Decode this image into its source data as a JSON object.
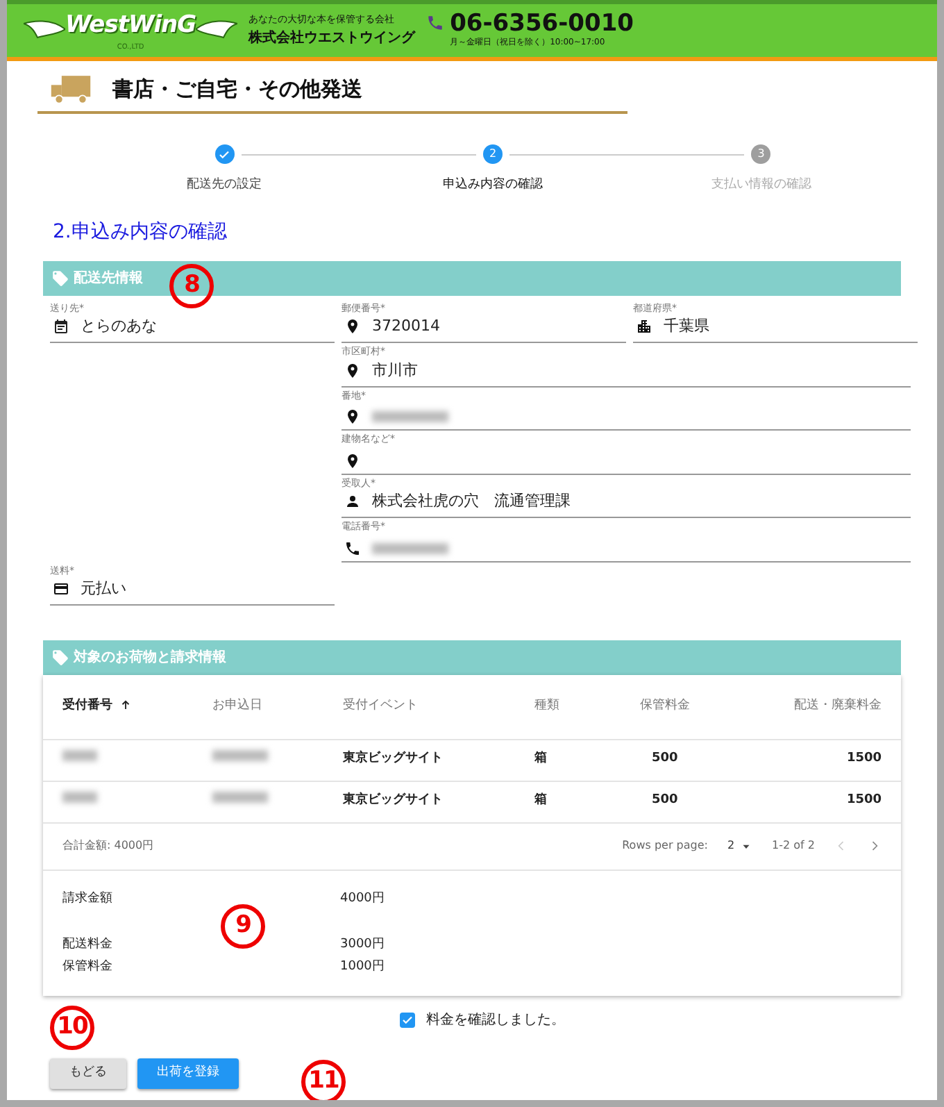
{
  "header": {
    "logo": "WestWinG",
    "logo_sub": "CO.,LTD",
    "tagline": "あなたの大切な本を保管する会社",
    "company": "株式会社ウエストウイング",
    "phone": "06-6356-0010",
    "hours": "月～金曜日（祝日を除く）10:00~17:00"
  },
  "page_title": "書店・ご自宅・その他発送",
  "steps": [
    {
      "label": "配送先の設定",
      "done": true,
      "selected": false
    },
    {
      "label": "申込み内容の確認",
      "number": "2",
      "done": false,
      "selected": true
    },
    {
      "label": "支払い情報の確認",
      "number": "3",
      "done": false,
      "selected": false
    }
  ],
  "section_heading": "2.申込み内容の確認",
  "address_section": {
    "title": "配送先情報",
    "fields": [
      {
        "label": "送り先*",
        "kind": "calendar",
        "value": "とらのあな",
        "redacted": false
      },
      {
        "label": "郵便番号*",
        "kind": "pin",
        "value": "3720014",
        "redacted": false
      },
      {
        "label": "都道府県*",
        "kind": "city",
        "value": "千葉県",
        "redacted": false
      },
      {
        "label": "市区町村*",
        "kind": "pin",
        "value": "市川市",
        "redacted": false
      },
      {
        "label": "番地*",
        "kind": "pin",
        "redacted": true
      },
      {
        "label": "建物名など*",
        "kind": "pin",
        "redacted": false
      },
      {
        "label": "受取人*",
        "kind": "person",
        "value": "株式会社虎の穴　流通管理課",
        "redacted": false
      },
      {
        "label": "電話番号*",
        "kind": "phone",
        "redacted": true
      },
      {
        "label": "送料*",
        "kind": "card",
        "value": "元払い",
        "redacted": false
      }
    ]
  },
  "items_section": {
    "title": "対象のお荷物と請求情報",
    "table": {
      "columns": [
        {
          "label": "受付番号",
          "sorted": true
        },
        {
          "label": "お申込日",
          "sorted": false
        },
        {
          "label": "受付イベント",
          "sorted": false
        },
        {
          "label": "種類",
          "sorted": false
        },
        {
          "label": "保管料金",
          "sorted": false
        },
        {
          "label": "配送・廃棄料金",
          "sorted": false
        }
      ],
      "rows": [
        [
          {
            "text": "",
            "redacted": true
          },
          {
            "text": "",
            "redacted": true
          },
          {
            "text": "東京ビッグサイト",
            "redacted": false
          },
          {
            "text": "箱",
            "redacted": false
          },
          {
            "text": "500",
            "redacted": false
          },
          {
            "text": "1500",
            "redacted": false
          }
        ],
        [
          {
            "text": "",
            "redacted": true
          },
          {
            "text": "",
            "redacted": true
          },
          {
            "text": "東京ビッグサイト",
            "redacted": false
          },
          {
            "text": "箱",
            "redacted": false
          },
          {
            "text": "500",
            "redacted": false
          },
          {
            "text": "1500",
            "redacted": false
          }
        ]
      ]
    },
    "footer": {
      "total": "合計金額: 4000円",
      "rows_per_page_label": "Rows per page:",
      "rows_per_page": "2",
      "range": "1-2 of 2",
      "prev_disabled": true,
      "next_disabled": false
    },
    "summary": [
      {
        "label": "請求金額",
        "value": "4000円"
      },
      {
        "label": "配送料金",
        "value": "3000円"
      },
      {
        "label": "保管料金",
        "value": "1000円"
      }
    ]
  },
  "confirm": {
    "label": "料金を確認しました。",
    "checked": true
  },
  "buttons": [
    {
      "label": "もどる",
      "kind": "secondary"
    },
    {
      "label": "出荷を登録",
      "kind": "primary"
    }
  ],
  "annotations": [
    "8",
    "9",
    "10",
    "11"
  ]
}
